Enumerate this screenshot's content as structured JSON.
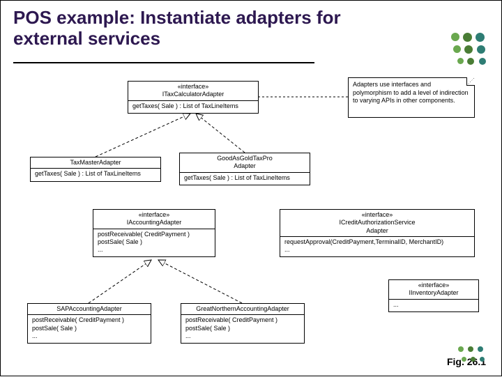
{
  "slide": {
    "title": "POS example: Instantiate adapters for external services",
    "caption": "Fig. 26.1"
  },
  "note": {
    "text": "Adapters use interfaces and polymorphism to add a level of indirection to varying APIs in other components."
  },
  "boxes": {
    "itax": {
      "stereotype": "«interface»",
      "name": "ITaxCalculatorAdapter",
      "op1": "getTaxes( Sale ) : List of TaxLineItems"
    },
    "taxmaster": {
      "name": "TaxMasterAdapter",
      "op1": "getTaxes( Sale ) : List of TaxLineItems"
    },
    "goodgold": {
      "line1": "GoodAsGoldTaxPro",
      "line2": "Adapter",
      "op1": "getTaxes( Sale ) : List of TaxLineItems"
    },
    "iacct": {
      "stereotype": "«interface»",
      "name": "IAccountingAdapter",
      "op1": "postReceivable( CreditPayment )",
      "op2": "postSale( Sale )",
      "op3": "..."
    },
    "icredit": {
      "stereotype": "«interface»",
      "name": "ICreditAuthorizationService",
      "name2": "Adapter",
      "op1": "requestApproval(CreditPayment,TerminalID, MerchantID)",
      "op2": "..."
    },
    "iinv": {
      "stereotype": "«interface»",
      "name": "IInventoryAdapter",
      "op1": "..."
    },
    "sap": {
      "name": "SAPAccountingAdapter",
      "op1": "postReceivable( CreditPayment )",
      "op2": "postSale( Sale )",
      "op3": "..."
    },
    "gna": {
      "name": "GreatNorthernAccountingAdapter",
      "op1": "postReceivable( CreditPayment )",
      "op2": "postSale( Sale )",
      "op3": "..."
    }
  },
  "colors": {
    "title": "#2d1850",
    "deco_green1": "#6aa84f",
    "deco_green2": "#4a7d35",
    "deco_teal": "#2e7d74"
  }
}
